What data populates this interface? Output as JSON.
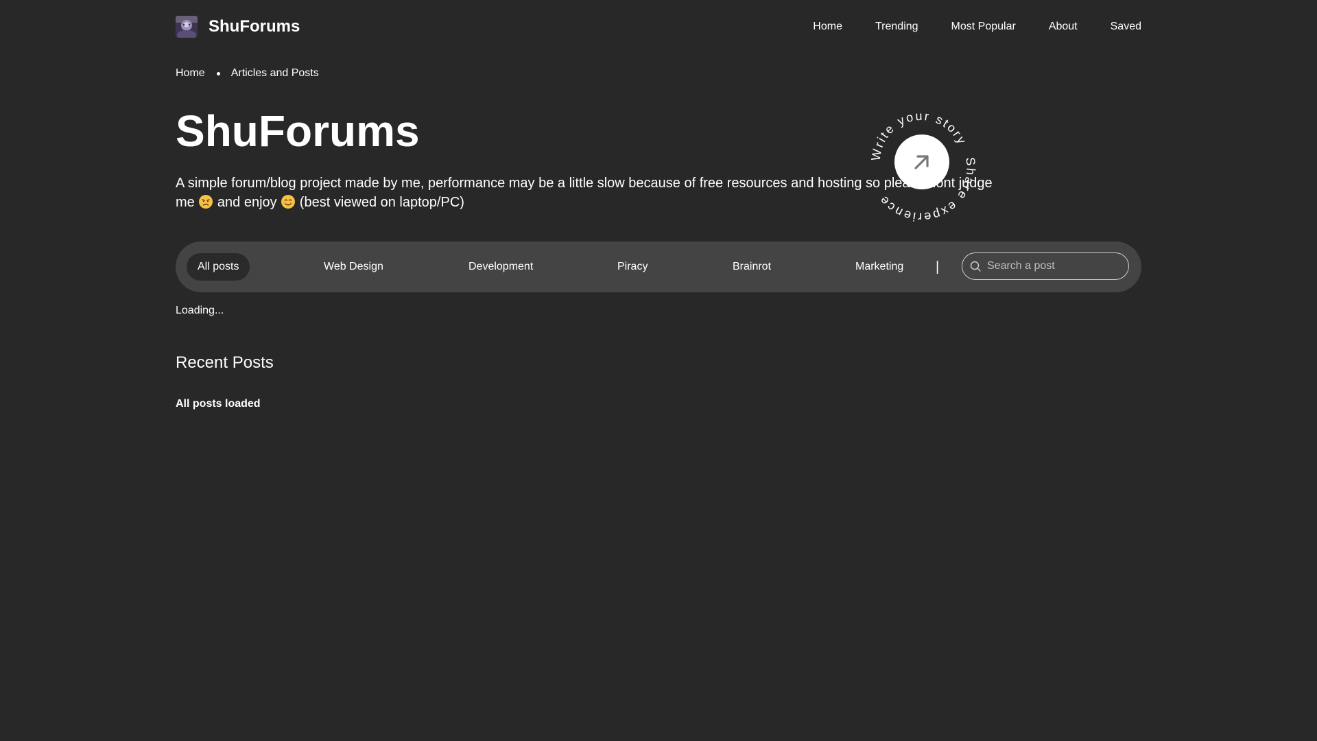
{
  "header": {
    "brand": "ShuForums",
    "nav": [
      "Home",
      "Trending",
      "Most Popular",
      "About",
      "Saved"
    ]
  },
  "breadcrumb": {
    "home": "Home",
    "current": "Articles and Posts"
  },
  "hero": {
    "title": "ShuForums",
    "description_part1": "A simple forum/blog project made by me, performance may be a little slow because of free resources and hosting so please dont judge me",
    "emoji_sad": "disappointed-face",
    "description_part2": "and enjoy",
    "emoji_smile": "smiling-face",
    "description_part3": "(best viewed on laptop/PC)"
  },
  "badge": {
    "text_top": "Write your story",
    "text_bottom": "Share experience",
    "icon": "arrow-up-right-icon"
  },
  "filters": {
    "categories": [
      "All posts",
      "Web Design",
      "Development",
      "Piracy",
      "Brainrot",
      "Marketing"
    ],
    "active": "All posts",
    "divider": "|",
    "search_placeholder": "Search a post"
  },
  "status": {
    "loading": "Loading...",
    "recent_title": "Recent Posts",
    "all_loaded": "All posts loaded"
  },
  "colors": {
    "background": "#282828",
    "filter_bar": "#444444",
    "active_chip": "#2a2a2a",
    "text": "#ffffff"
  }
}
